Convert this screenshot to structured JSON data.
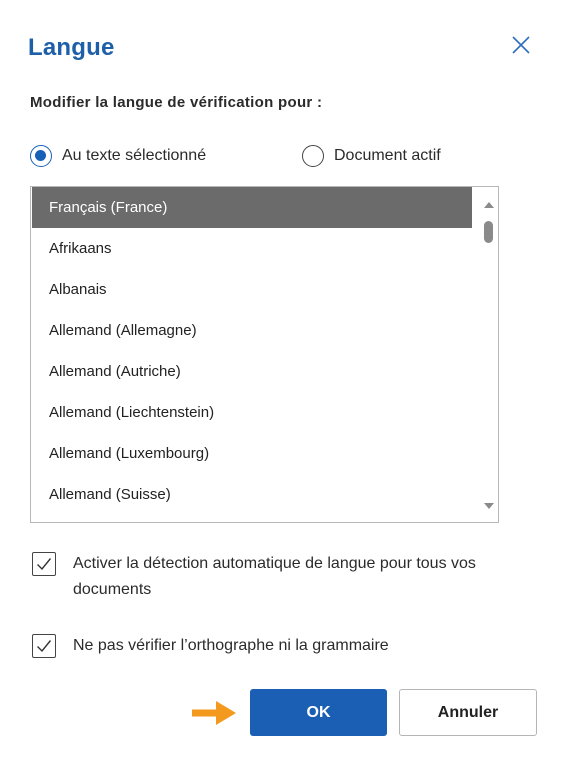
{
  "dialog": {
    "title": "Langue",
    "close_icon": "close-icon",
    "subtitle": "Modifier la langue de vérification pour :"
  },
  "scope": {
    "options": [
      {
        "label": "Au texte sélectionné",
        "checked": true
      },
      {
        "label": "Document actif",
        "checked": false
      }
    ]
  },
  "languages": {
    "selected": "Français (France)",
    "items": [
      "Français (France)",
      "Afrikaans",
      "Albanais",
      "Allemand (Allemagne)",
      "Allemand (Autriche)",
      "Allemand (Liechtenstein)",
      "Allemand (Luxembourg)",
      "Allemand (Suisse)"
    ]
  },
  "options": {
    "auto_detect": {
      "label": "Activer la détection automatique de langue pour tous vos documents",
      "checked": true
    },
    "no_proofing": {
      "label": "Ne pas vérifier l’orthographe ni la grammaire",
      "checked": true
    }
  },
  "buttons": {
    "ok_label": "OK",
    "cancel_label": "Annuler"
  },
  "annotation": {
    "icon": "arrow-right-icon",
    "color": "#f39a1e"
  },
  "colors": {
    "title": "#1d5fa8",
    "accent": "#1b5fb5",
    "selected_row": "#6b6b6b"
  }
}
